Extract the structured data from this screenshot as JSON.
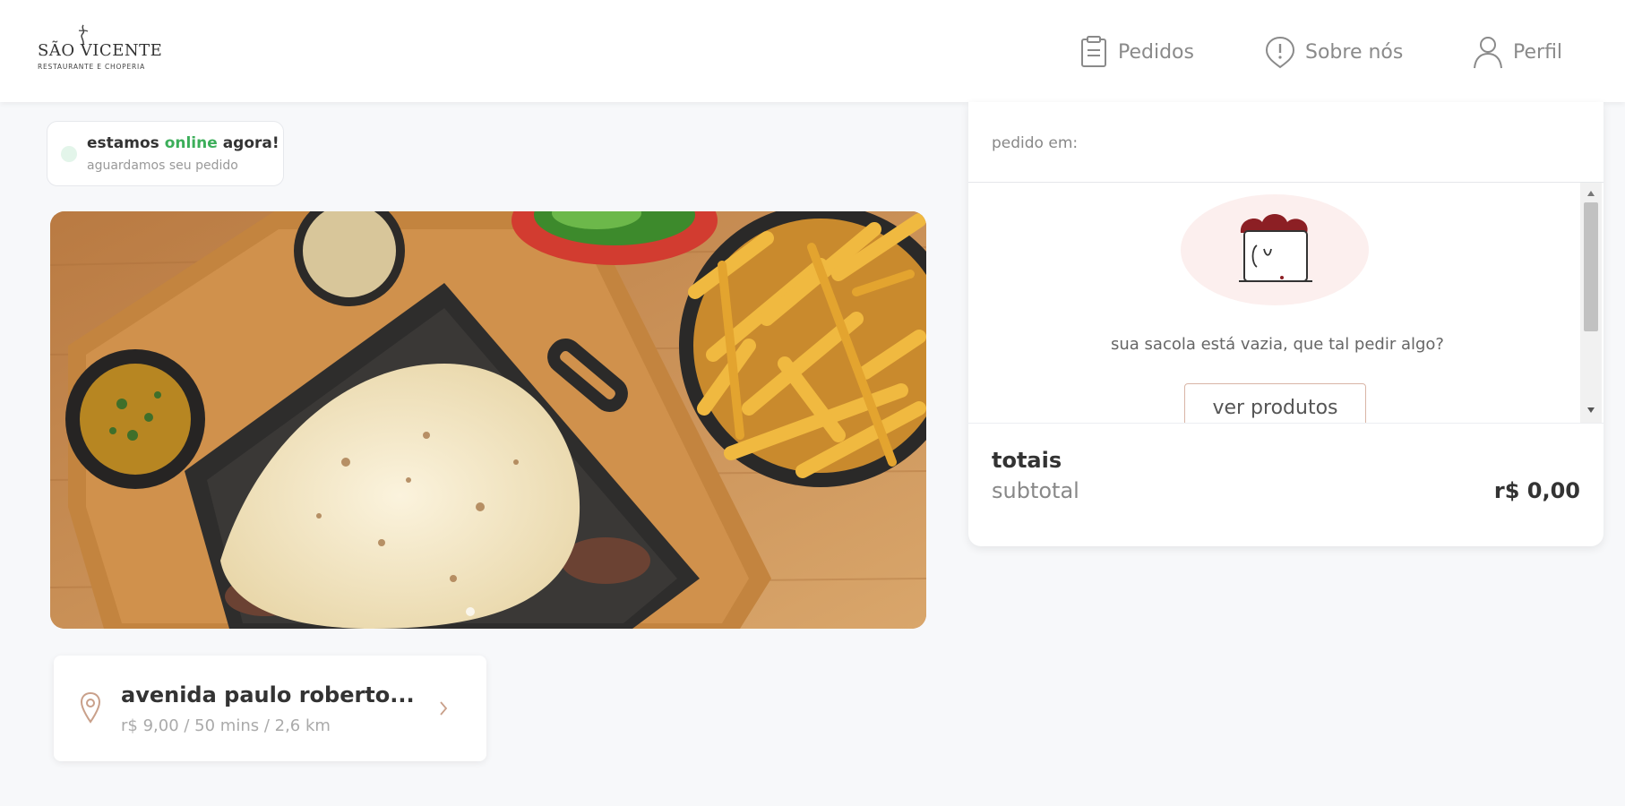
{
  "header": {
    "logo": {
      "name": "SÃO VICENTE",
      "subtitle": "RESTAURANTE E CHOPERIA"
    },
    "nav": [
      {
        "label": "Pedidos",
        "icon": "receipt-icon"
      },
      {
        "label": "Sobre nós",
        "icon": "info-icon"
      },
      {
        "label": "Perfil",
        "icon": "user-icon"
      }
    ]
  },
  "status": {
    "prefix": "estamos",
    "highlight": "online",
    "suffix": "agora!",
    "subtitle": "aguardamos seu pedido",
    "colors": {
      "online": "#3cae5a",
      "dot": "#e3f5ea"
    }
  },
  "banner": {
    "image": "food-photo",
    "carousel_index": 1
  },
  "address": {
    "street": "avenida paulo roberto...",
    "info": "r$ 9,00 / 50 mins / 2,6 km",
    "icon": "location-pin-icon"
  },
  "cart": {
    "order_in_label": "pedido em:",
    "empty_message": "sua sacola está vazia, que tal pedir algo?",
    "see_products_label": "ver produtos",
    "totals_label": "totais",
    "subtotal_label": "subtotal",
    "subtotal_value": "r$ 0,00",
    "mascot": "chef-mascot-illustration"
  }
}
